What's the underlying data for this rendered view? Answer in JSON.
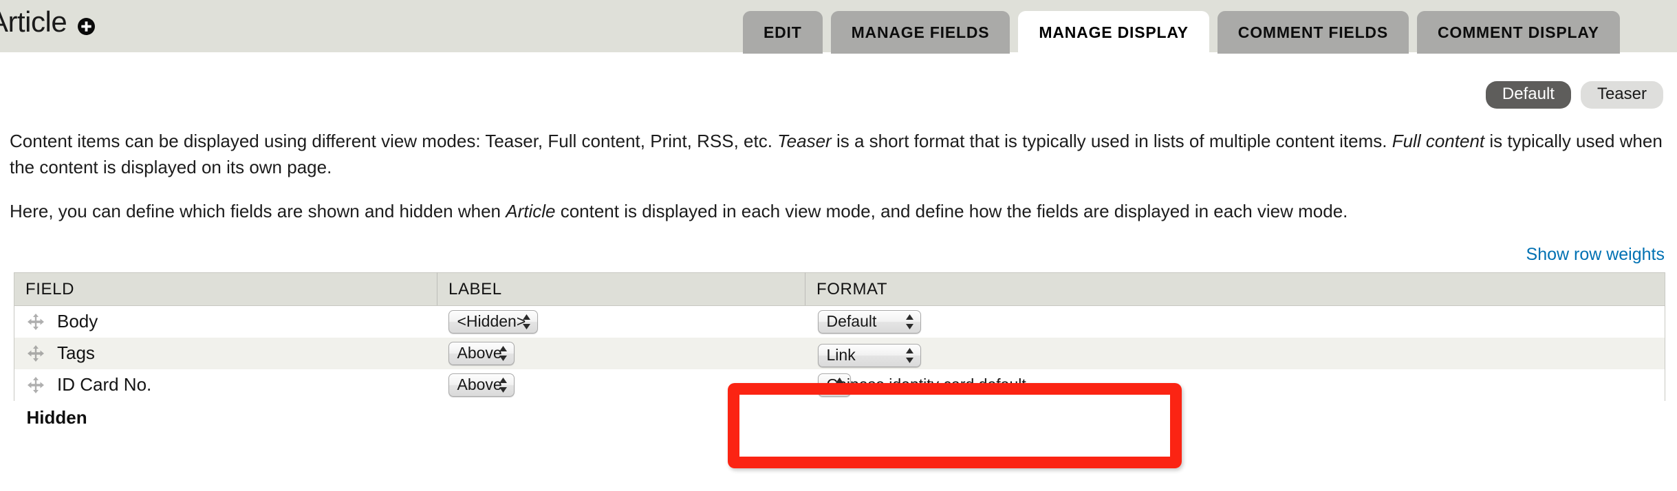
{
  "header": {
    "title": "Article",
    "add_icon": "plus-circle-icon",
    "background_color": "#dfe0d9"
  },
  "tabs": [
    {
      "label": "EDIT",
      "active": false
    },
    {
      "label": "MANAGE FIELDS",
      "active": false
    },
    {
      "label": "MANAGE DISPLAY",
      "active": true
    },
    {
      "label": "COMMENT FIELDS",
      "active": false
    },
    {
      "label": "COMMENT DISPLAY",
      "active": false
    }
  ],
  "view_modes": [
    {
      "label": "Default",
      "active": true
    },
    {
      "label": "Teaser",
      "active": false
    }
  ],
  "description": {
    "paragraph_1_part_1": "Content items can be displayed using different view modes: Teaser, Full content, Print, RSS, etc. ",
    "paragraph_1_em_1": "Teaser",
    "paragraph_1_part_2": " is a short format that is typically used in lists of multiple content items. ",
    "paragraph_1_em_2": "Full content",
    "paragraph_1_part_3": " is typically used when the content is displayed on its own page.",
    "paragraph_2_part_1": "Here, you can define which fields are shown and hidden when ",
    "paragraph_2_em_1": "Article",
    "paragraph_2_part_2": " content is displayed in each view mode, and define how the fields are displayed in each view mode."
  },
  "row_weights_link": "Show row weights",
  "table": {
    "columns": [
      "FIELD",
      "LABEL",
      "FORMAT"
    ],
    "rows": [
      {
        "field": "Body",
        "label": "<Hidden>",
        "format": "Default",
        "drag_icon": "move-handle-icon"
      },
      {
        "field": "Tags",
        "label": "Above",
        "format": "Link",
        "drag_icon": "move-handle-icon"
      },
      {
        "field": "ID Card No.",
        "label": "Above",
        "format": "Chinese identity card default",
        "drag_icon": "move-handle-icon"
      }
    ],
    "hidden_section_label": "Hidden"
  },
  "annotation": {
    "color": "#fb2413",
    "target": "format-select-id-card-no"
  }
}
